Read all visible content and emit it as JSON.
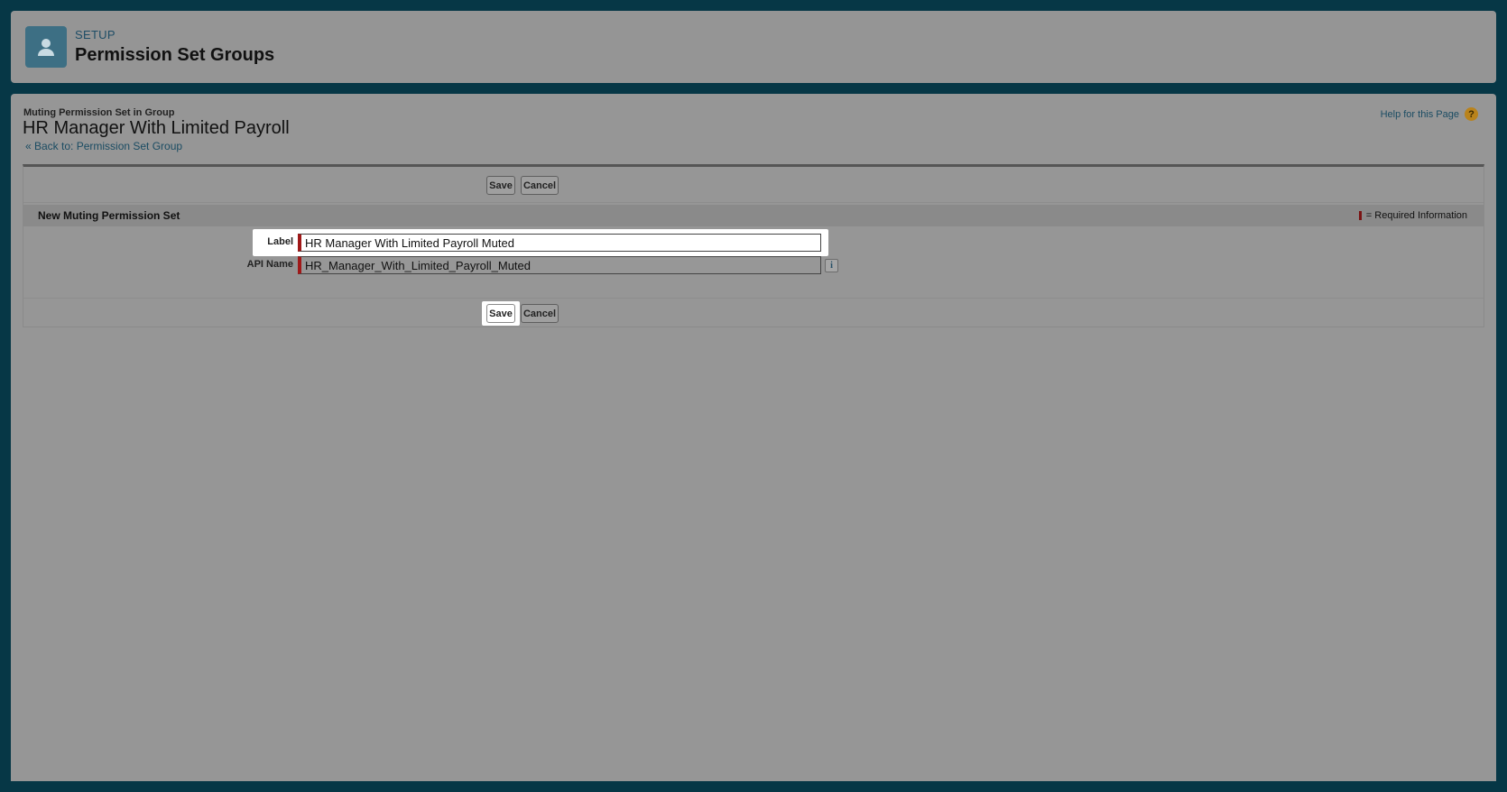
{
  "header": {
    "eyebrow": "SETUP",
    "title": "Permission Set Groups",
    "icon": "user-icon"
  },
  "page": {
    "eyebrow": "Muting Permission Set in Group",
    "title": "HR Manager With Limited Payroll",
    "back_link": "« Back to: Permission Set Group",
    "help_link": "Help for this Page",
    "help_icon": "?"
  },
  "toolbar": {
    "save_label": "Save",
    "cancel_label": "Cancel"
  },
  "section": {
    "title": "New Muting Permission Set",
    "required_legend": "= Required Information"
  },
  "form": {
    "label_field": {
      "label": "Label",
      "value": "HR Manager With Limited Payroll Muted"
    },
    "api_name_field": {
      "label": "API Name",
      "value": "HR_Manager_With_Limited_Payroll_Muted",
      "info_icon": "i"
    }
  },
  "colors": {
    "background": "#063746",
    "panel": "#969696",
    "required": "#a01818",
    "link": "#1b4c63"
  }
}
